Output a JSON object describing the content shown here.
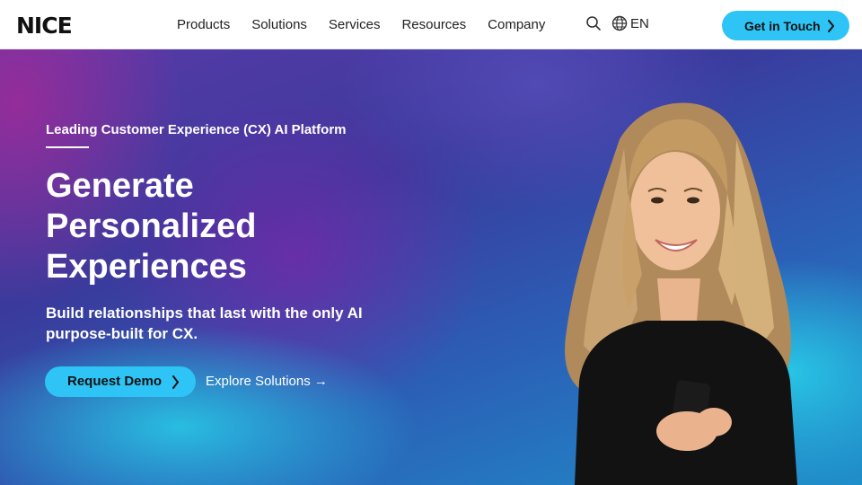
{
  "header": {
    "logo": "NICE",
    "nav": [
      "Products",
      "Solutions",
      "Services",
      "Resources",
      "Company"
    ],
    "language": "EN",
    "cta": "Get in Touch"
  },
  "hero": {
    "eyebrow": "Leading Customer Experience (CX) AI Platform",
    "headline_lines": [
      "Generate",
      "Personalized",
      "Experiences"
    ],
    "subtext": "Build relationships that last with the only AI purpose-built for CX.",
    "primary_cta": "Request Demo",
    "secondary_cta": "Explore Solutions →"
  },
  "colors": {
    "accent": "#2fc4f6",
    "hero_purple": "#6a2a9c",
    "hero_blue": "#2b5fb6",
    "hero_cyan": "#28c8e6"
  },
  "icons": [
    "search-icon",
    "globe-icon",
    "chevron-right-icon"
  ]
}
